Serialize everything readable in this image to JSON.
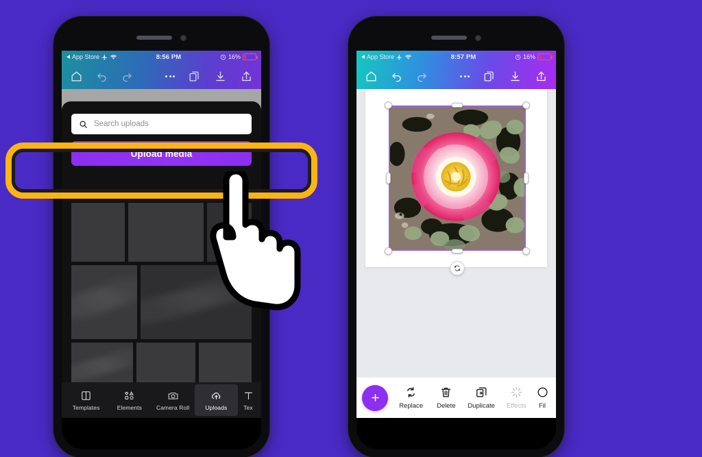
{
  "background_color": "#4a2ac4",
  "phones": [
    {
      "id": "left",
      "status_bar": {
        "carrier_label": "App Store",
        "time": "8:56 PM",
        "battery_percent": "16%",
        "alarm_icon": "alarm-icon",
        "airplane_icon": "airplane-mode-icon",
        "wifi_icon": "wifi-icon",
        "back_icon": "back-arrow-icon"
      },
      "toolbar": {
        "icons_left": [
          "home-icon",
          "undo-icon",
          "redo-icon"
        ],
        "icons_right": [
          "more-options-icon",
          "layers-icon",
          "download-icon",
          "share-icon"
        ]
      },
      "panel": {
        "search_placeholder": "Search uploads",
        "search_icon": "search-icon",
        "upload_button_label": "Upload media",
        "upload_button_color": "#8b2ff0"
      },
      "tabs": [
        {
          "label": "Templates",
          "icon": "templates-icon",
          "selected": false
        },
        {
          "label": "Elements",
          "icon": "elements-icon",
          "selected": false
        },
        {
          "label": "Camera Roll",
          "icon": "camera-icon",
          "selected": false
        },
        {
          "label": "Uploads",
          "icon": "upload-cloud-icon",
          "selected": true
        },
        {
          "label": "Tex",
          "icon": "text-icon",
          "selected": false
        }
      ]
    },
    {
      "id": "right",
      "status_bar": {
        "carrier_label": "App Store",
        "time": "8:57 PM",
        "battery_percent": "16%",
        "alarm_icon": "alarm-icon",
        "airplane_icon": "airplane-mode-icon",
        "wifi_icon": "wifi-icon",
        "back_icon": "back-arrow-icon"
      },
      "toolbar": {
        "icons_left": [
          "home-icon",
          "undo-icon",
          "redo-icon"
        ],
        "icons_right": [
          "more-options-icon",
          "layers-icon",
          "download-icon",
          "share-icon"
        ]
      },
      "canvas": {
        "selected_object": "photo-rose",
        "selection_color": "#9a63d8",
        "rotate_handle_icon": "rotate-icon"
      },
      "actions": [
        {
          "label": "Replace",
          "icon": "replace-icon",
          "disabled": false
        },
        {
          "label": "Delete",
          "icon": "trash-icon",
          "disabled": false
        },
        {
          "label": "Duplicate",
          "icon": "duplicate-icon",
          "disabled": false
        },
        {
          "label": "Effects",
          "icon": "sparkle-icon",
          "disabled": true
        },
        {
          "label": "Fil",
          "icon": "filter-icon",
          "disabled": false
        }
      ],
      "add_button": {
        "icon": "plus-icon",
        "color": "#8b2ff0"
      }
    }
  ],
  "annotation": {
    "highlight_color": "#fcb510",
    "highlight_target": "Upload media",
    "cursor_icon": "pointing-hand-cursor"
  }
}
